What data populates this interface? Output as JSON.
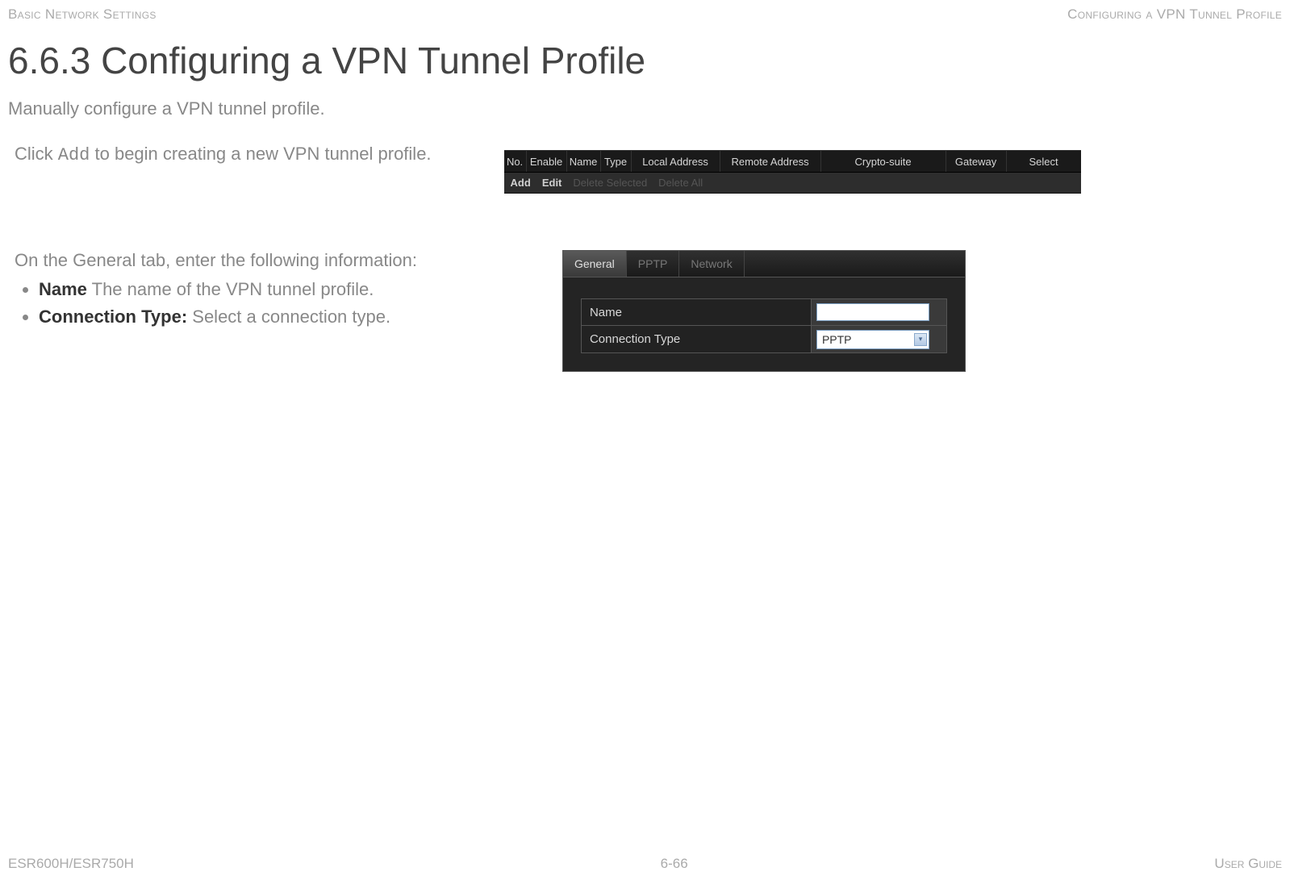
{
  "header": {
    "left": "Basic Network Settings",
    "right": "Configuring a VPN Tunnel Profile"
  },
  "title": "6.6.3 Configuring a VPN Tunnel Profile",
  "subtitle": "Manually configure a VPN tunnel profile.",
  "step1": {
    "pre": "Click ",
    "code": "Add",
    "post": " to begin creating a new VPN tunnel profile."
  },
  "table": {
    "headers": [
      "No.",
      "Enable",
      "Name",
      "Type",
      "Local Address",
      "Remote Address",
      "Crypto-suite",
      "Gateway",
      "Select"
    ],
    "buttons": [
      "Add",
      "Edit",
      "Delete Selected",
      "Delete All"
    ]
  },
  "step2": {
    "intro": "On the General tab, enter the following information:",
    "items": [
      {
        "bold": "Name",
        "rest": "  The name of the VPN tunnel profile."
      },
      {
        "bold": "Connection Type:",
        "rest": " Select a connection type."
      }
    ]
  },
  "panel": {
    "tabs": [
      "General",
      "PPTP",
      "Network"
    ],
    "rows": {
      "name_label": "Name",
      "conn_label": "Connection Type",
      "conn_value": "PPTP"
    }
  },
  "footer": {
    "left": "ESR600H/ESR750H",
    "center": "6-66",
    "right": "User Guide"
  }
}
